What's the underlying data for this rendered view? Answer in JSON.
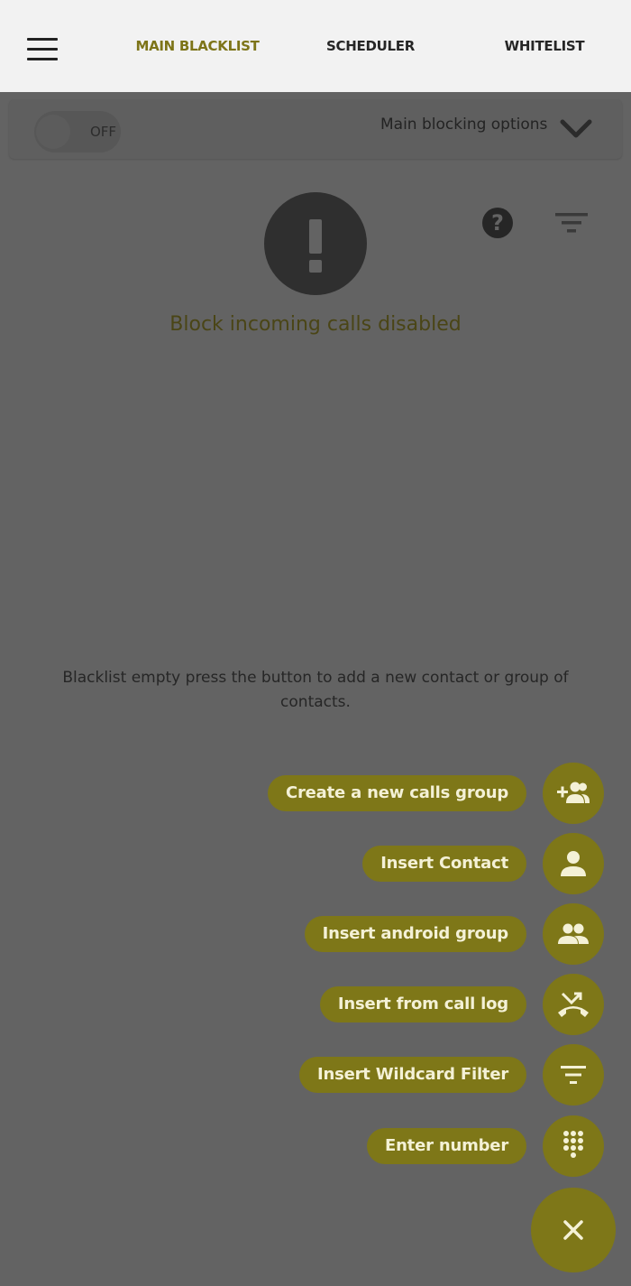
{
  "header": {
    "tabs": [
      {
        "label": "MAIN BLACKLIST",
        "active": true
      },
      {
        "label": "SCHEDULER",
        "active": false
      },
      {
        "label": "WHITELIST",
        "active": false
      }
    ]
  },
  "options": {
    "toggle_state": "OFF",
    "label": "Main blocking options"
  },
  "status": {
    "message": "Block incoming calls disabled"
  },
  "empty_message": "Blacklist empty press the button to add a new contact or group of contacts.",
  "actions": [
    {
      "label": "Create a new calls group",
      "icon": "add-group-icon"
    },
    {
      "label": "Insert Contact",
      "icon": "person-icon"
    },
    {
      "label": "Insert android group",
      "icon": "people-icon"
    },
    {
      "label": "Insert from call log",
      "icon": "missed-call-icon"
    },
    {
      "label": "Insert Wildcard Filter",
      "icon": "filter-icon"
    },
    {
      "label": "Enter number",
      "icon": "dialpad-icon"
    }
  ],
  "colors": {
    "accent": "#7e7718",
    "active_tab": "#7d7418",
    "overlay_background": "#636363"
  }
}
